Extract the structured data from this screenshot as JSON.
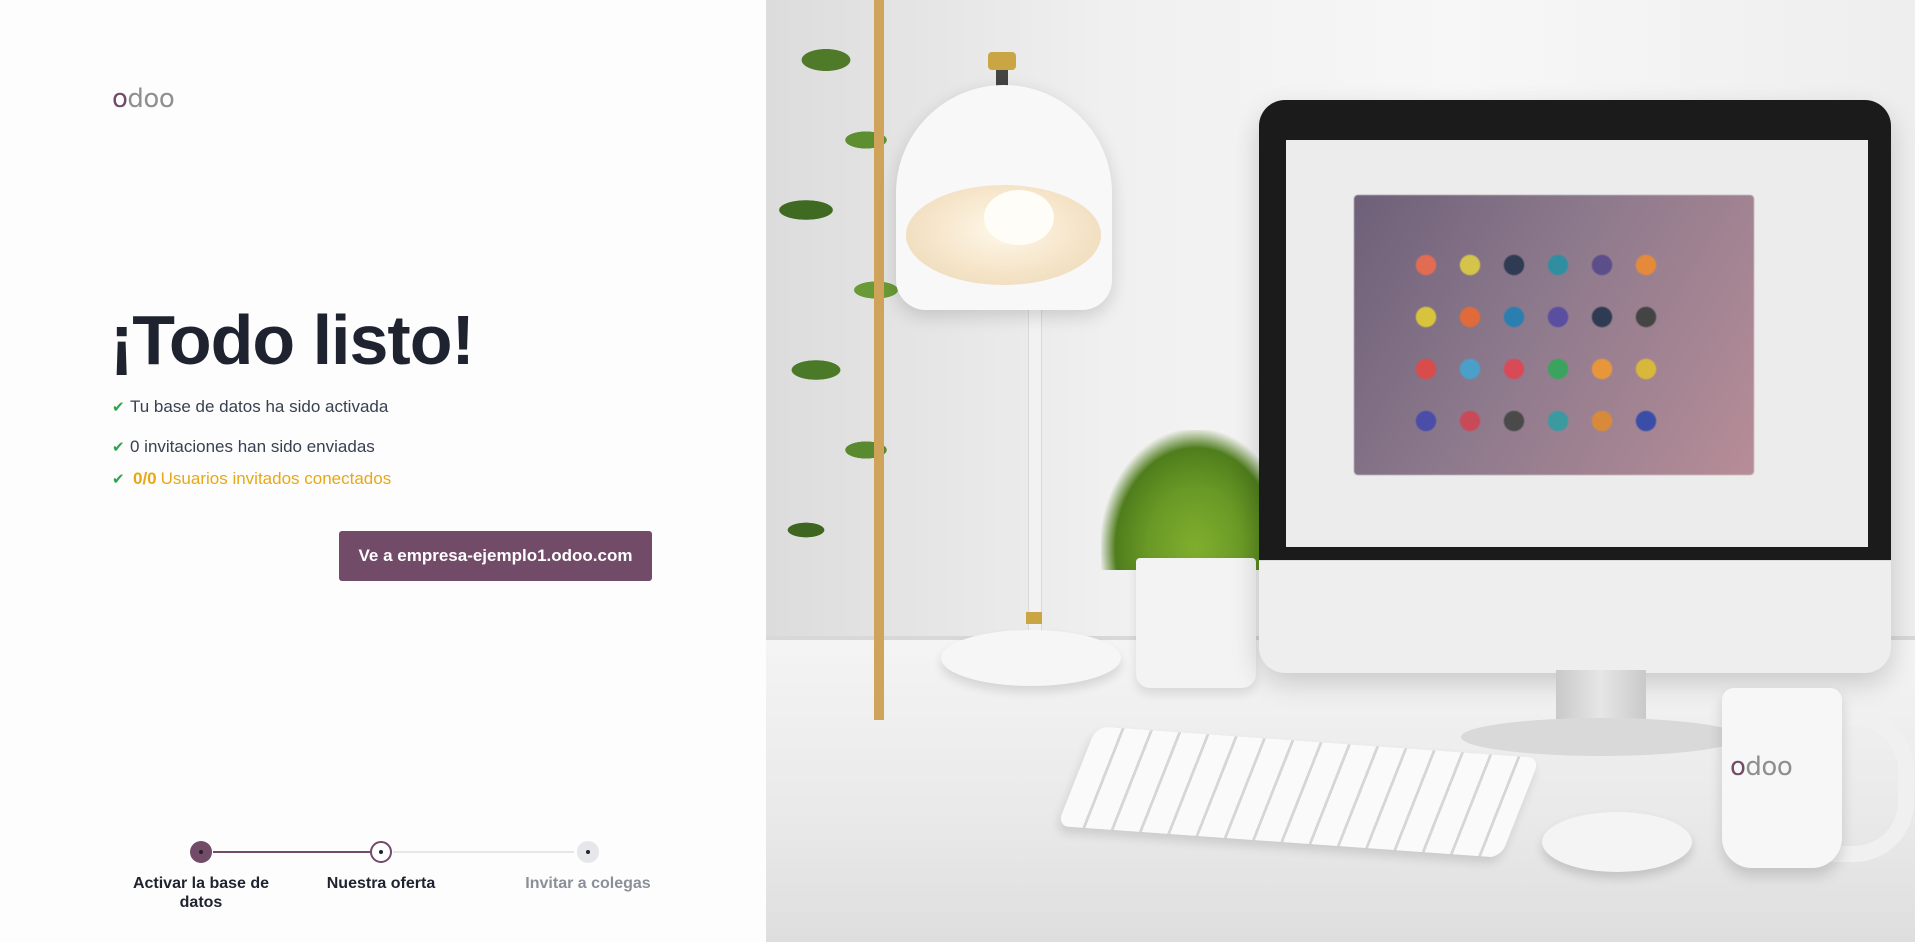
{
  "brand": {
    "logo_first": "o",
    "logo_rest": "doo",
    "color_primary": "#714B67"
  },
  "main": {
    "headline": "¡Todo listo!",
    "checklist": [
      {
        "icon": "check-icon",
        "text": "Tu base de datos ha sido activada"
      },
      {
        "icon": "check-icon",
        "text": "0 invitaciones han sido enviadas"
      },
      {
        "icon": "check-icon",
        "count": "0/0",
        "text": "Usuarios invitados conectados"
      }
    ],
    "cta_label": "Ve a empresa-ejemplo1.odoo.com"
  },
  "stepper": {
    "steps": [
      {
        "label": "Activar la base de datos",
        "state": "done"
      },
      {
        "label": "Nuestra oferta",
        "state": "current"
      },
      {
        "label": "Invitar a colegas",
        "state": "todo"
      }
    ]
  },
  "illustration": {
    "mug_logo_first": "o",
    "mug_logo_rest": "doo"
  }
}
